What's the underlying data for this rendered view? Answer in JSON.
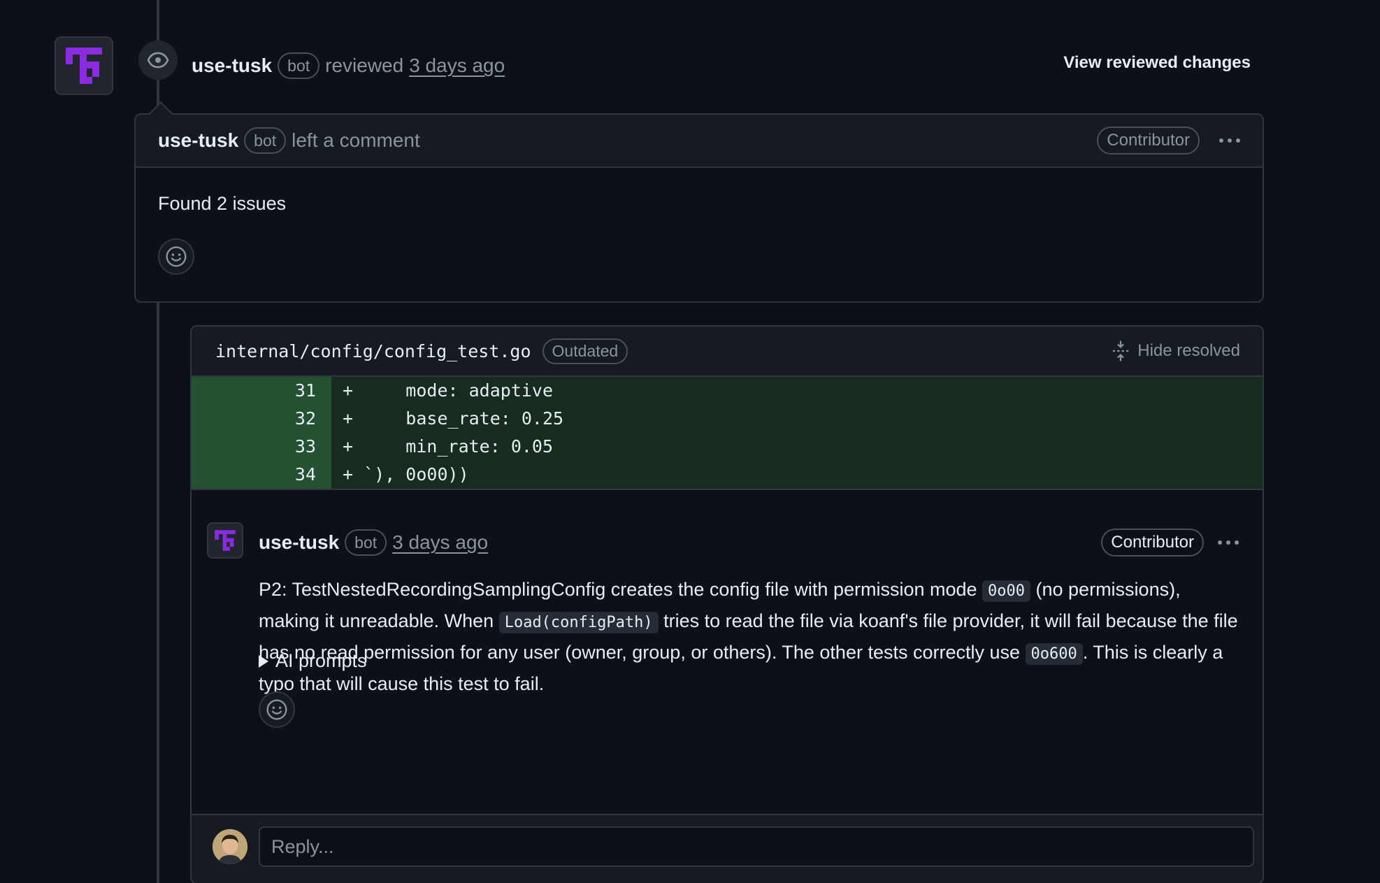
{
  "review": {
    "author": "use-tusk",
    "bot_label": "bot",
    "action": "reviewed",
    "time": "3 days ago",
    "view_changes": "View reviewed changes"
  },
  "summary_comment": {
    "author": "use-tusk",
    "bot_label": "bot",
    "action": "left a comment",
    "role": "Contributor",
    "body": "Found 2 issues"
  },
  "thread": {
    "file_path": "internal/config/config_test.go",
    "outdated_label": "Outdated",
    "hide_resolved": "Hide resolved",
    "diff": [
      {
        "line": "31",
        "code": "+     mode: adaptive"
      },
      {
        "line": "32",
        "code": "+     base_rate: 0.25"
      },
      {
        "line": "33",
        "code": "+     min_rate: 0.05"
      },
      {
        "line": "34",
        "code": "+ `), 0o00))"
      }
    ],
    "comment": {
      "author": "use-tusk",
      "bot_label": "bot",
      "time": "3 days ago",
      "role": "Contributor",
      "text_1": "P2: TestNestedRecordingSamplingConfig creates the config file with permission mode ",
      "code_1": "0o00",
      "text_2": " (no permissions), making it unreadable. When ",
      "code_2": "Load(configPath)",
      "text_3": " tries to read the file via koanf's file provider, it will fail because the file has no read permission for any user (owner, group, or others). The other tests correctly use ",
      "code_3": "0o600",
      "text_4": ". This is clearly a typo that will cause this test to fail.",
      "ai_prompts": "AI prompts"
    },
    "reply_placeholder": "Reply..."
  },
  "colors": {
    "accent_purple": "#8a2be2",
    "diff_added": "#172c1f",
    "background": "#0d1117"
  }
}
